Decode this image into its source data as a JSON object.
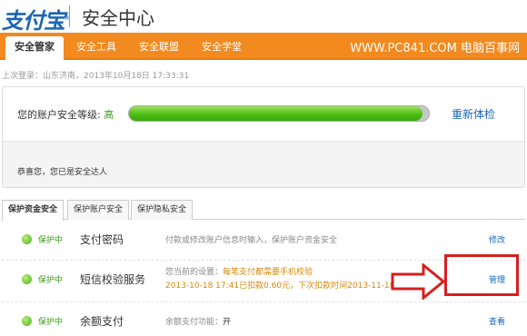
{
  "header": {
    "logo_text": "支付宝",
    "logo_mark": "®",
    "title": "安全中心"
  },
  "nav": {
    "tabs": [
      "安全管家",
      "安全工具",
      "安全联盟",
      "安全学堂"
    ],
    "active_tab": "安全管家",
    "right_text": "WWW.PC841.COM 电脑百事网"
  },
  "last_login": "上次登录：山东济南，2013年10月18日 17:33:31",
  "security_level": {
    "label": "您的账户安全等级:",
    "value": "高",
    "progress": 0.98,
    "recheck_link": "重新体检",
    "congrats": "恭喜您，您已是安全达人"
  },
  "tabs": [
    "保护资金安全",
    "保护账户安全",
    "保护隐私安全"
  ],
  "rows": [
    {
      "status": "保护中",
      "title": "支付密码",
      "desc": "付款或修改账户信息时输入，保护账户资金安全",
      "action": "修改"
    },
    {
      "status": "保护中",
      "title": "短信校验服务",
      "desc_label": "您当前的设置：",
      "desc_value": "每笔支付都需要手机校验",
      "desc_line2": "2013-10-18 17:41已扣款0.60元，下次扣款时间2013-11-18",
      "help_icon": "?",
      "action": "管理"
    },
    {
      "status": "保护中",
      "title": "余额支付",
      "desc_label": "余额支付功能：",
      "desc_value": "开",
      "action": "查看"
    }
  ],
  "colors": {
    "brand_blue": "#1c65b5",
    "nav_orange": "#f28a1f",
    "status_green": "#3a9b14",
    "highlight_red": "#d81e1e"
  }
}
